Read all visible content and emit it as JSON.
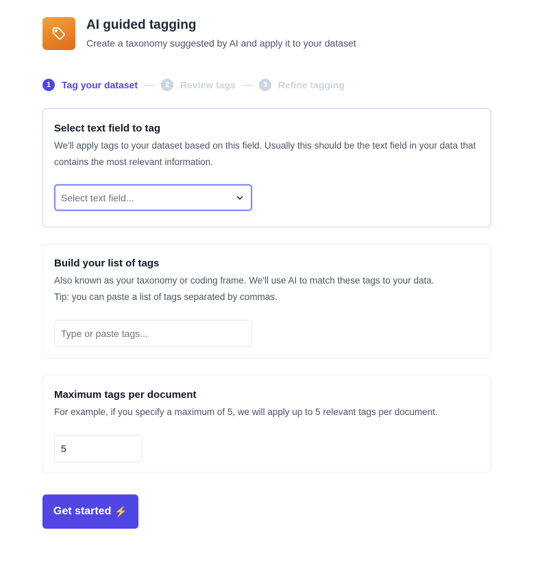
{
  "header": {
    "title": "AI guided tagging",
    "subtitle": "Create a taxonomy suggested by AI and apply it to your dataset",
    "logo_icon": "tag-icon"
  },
  "steps": [
    {
      "num": "1",
      "label": "Tag your dataset",
      "state": "active"
    },
    {
      "num": "2",
      "label": "Review tags",
      "state": "inactive"
    },
    {
      "num": "3",
      "label": "Refine tagging",
      "state": "inactive"
    }
  ],
  "text_field": {
    "title": "Select text field to tag",
    "description": "We'll apply tags to your dataset based on this field. Usually this should be the text field in your data that contains the most relevant information.",
    "placeholder": "Select text field...",
    "icon": "chevron-down-icon"
  },
  "tags": {
    "title": "Build your list of tags",
    "description": "Also known as your taxonomy or coding frame. We'll use AI to match these tags to your data.",
    "tip": "Tip: you can paste a list of tags separated by commas.",
    "placeholder": "Type or paste tags..."
  },
  "max_tags": {
    "title": "Maximum tags per document",
    "description": "For example, if you specify a maximum of 5, we will apply up to 5 relevant tags per document.",
    "value": "5"
  },
  "actions": {
    "submit_label": "Get started",
    "submit_icon": "⚡"
  },
  "colors": {
    "accent": "#4f46e5",
    "logo_gradient_start": "#f0a33a",
    "logo_gradient_end": "#e06a1c",
    "inactive_step": "#cbd5e1"
  }
}
